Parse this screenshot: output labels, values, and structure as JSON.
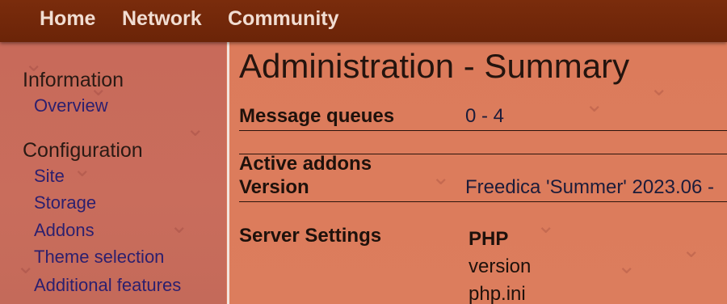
{
  "nav": {
    "items": [
      {
        "label": "Home"
      },
      {
        "label": "Network"
      },
      {
        "label": "Community"
      }
    ]
  },
  "sidebar": {
    "sections": [
      {
        "heading": "Information",
        "links": [
          "Overview"
        ]
      },
      {
        "heading": "Configuration",
        "links": [
          "Site",
          "Storage",
          "Addons",
          "Theme selection",
          "Additional features"
        ]
      }
    ]
  },
  "main": {
    "title": "Administration - Summary",
    "rows": [
      {
        "label": "Message queues",
        "value": "0 - 4"
      },
      {
        "label": "Active addons",
        "value": ""
      },
      {
        "label": "Version",
        "value": "Freedica 'Summer' 2023.06 -"
      }
    ],
    "server_settings": {
      "label": "Server Settings",
      "php_heading": "PHP",
      "php_items": [
        "version",
        "php.ini"
      ]
    }
  },
  "colors": {
    "topbar": "#6b2408",
    "sidebar_bg": "#c86a5a",
    "main_bg": "#dc7b5b",
    "link": "#2c1f6e"
  }
}
